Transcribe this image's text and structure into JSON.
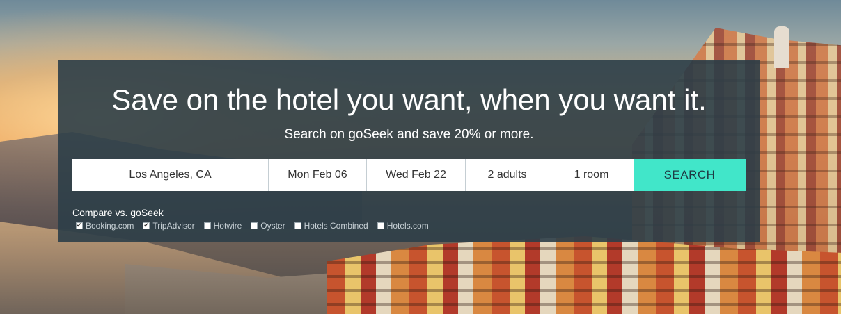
{
  "hero": {
    "headline": "Save on the hotel you want, when you want it.",
    "subheadline": "Search on goSeek and save 20% or more."
  },
  "search": {
    "destination": "Los Angeles, CA",
    "check_in": "Mon Feb 06",
    "check_out": "Wed Feb 22",
    "guests": "2 adults",
    "rooms": "1 room",
    "button_label": "SEARCH"
  },
  "compare": {
    "label": "Compare vs. goSeek",
    "options": [
      {
        "label": "Booking.com",
        "checked": true
      },
      {
        "label": "TripAdvisor",
        "checked": true
      },
      {
        "label": "Hotwire",
        "checked": false
      },
      {
        "label": "Oyster",
        "checked": false
      },
      {
        "label": "Hotels Combined",
        "checked": false
      },
      {
        "label": "Hotels.com",
        "checked": false
      }
    ]
  },
  "colors": {
    "panel_bg": "#2c3e48",
    "accent": "#41e6c9"
  }
}
